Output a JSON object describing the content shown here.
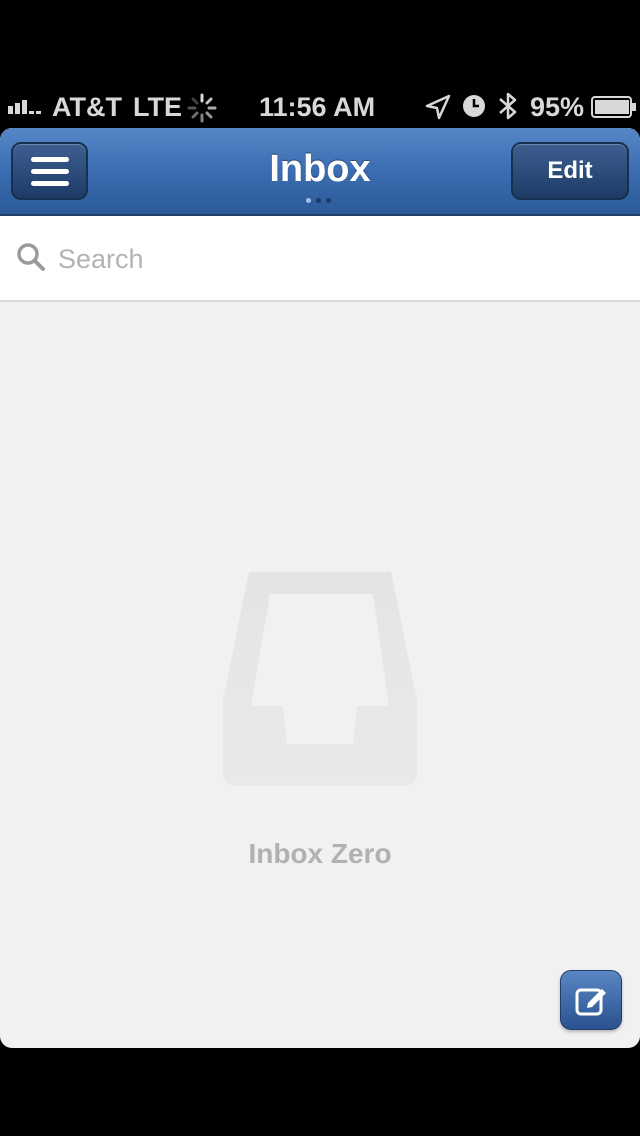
{
  "status_bar": {
    "carrier": "AT&T",
    "network": "LTE",
    "time": "11:56 AM",
    "battery_percent": "95%",
    "icons": [
      "signal-icon",
      "activity-spinner-icon",
      "location-icon",
      "alarm-icon",
      "bluetooth-icon",
      "battery-icon"
    ]
  },
  "nav_bar": {
    "title": "Inbox",
    "edit_label": "Edit",
    "menu_icon": "hamburger-icon",
    "page_dots_count": 3,
    "active_page_index": 0
  },
  "search": {
    "placeholder": "Search",
    "value": ""
  },
  "empty_state": {
    "icon": "inbox-tray-icon",
    "label": "Inbox Zero"
  },
  "compose": {
    "icon": "compose-icon"
  },
  "colors": {
    "nav_blue": "#3d6fb3",
    "button_navy": "#1e3b66",
    "background": "#f1f1f1",
    "empty_text": "#b1b1b1"
  }
}
